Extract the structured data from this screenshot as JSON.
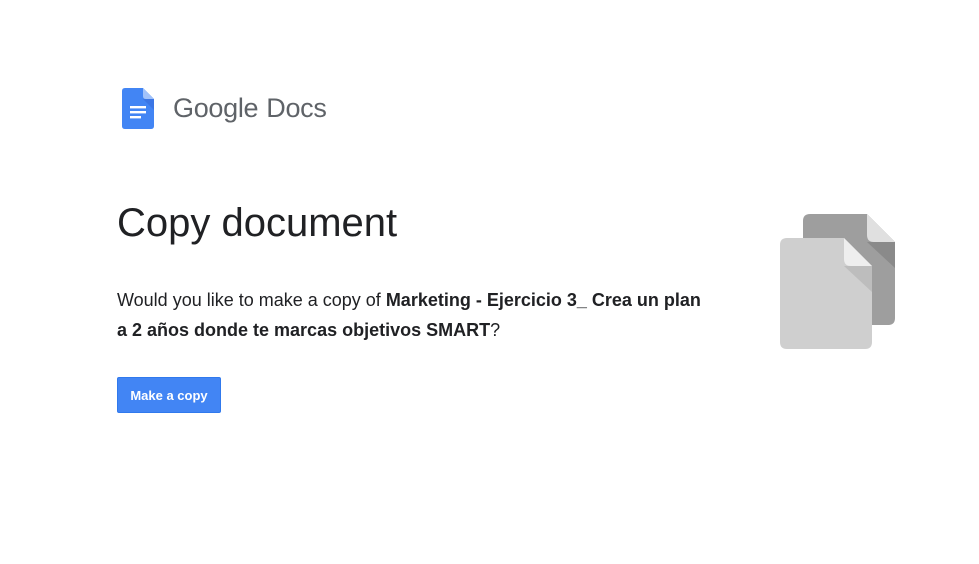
{
  "brand": {
    "company": "Google",
    "product": "Docs",
    "logo_icon": "google-docs-logo-icon",
    "logo_color": "#4285f4"
  },
  "page": {
    "title": "Copy document",
    "prompt_prefix": "Would you like to make a copy of ",
    "document_name": "Marketing - Ejercicio 3_ Crea un plan a 2 años donde te marcas objetivos SMART",
    "prompt_suffix": "?"
  },
  "actions": {
    "make_copy_label": "Make a copy",
    "button_color": "#4285f4"
  },
  "illustration": {
    "icon": "copy-documents-icon"
  }
}
